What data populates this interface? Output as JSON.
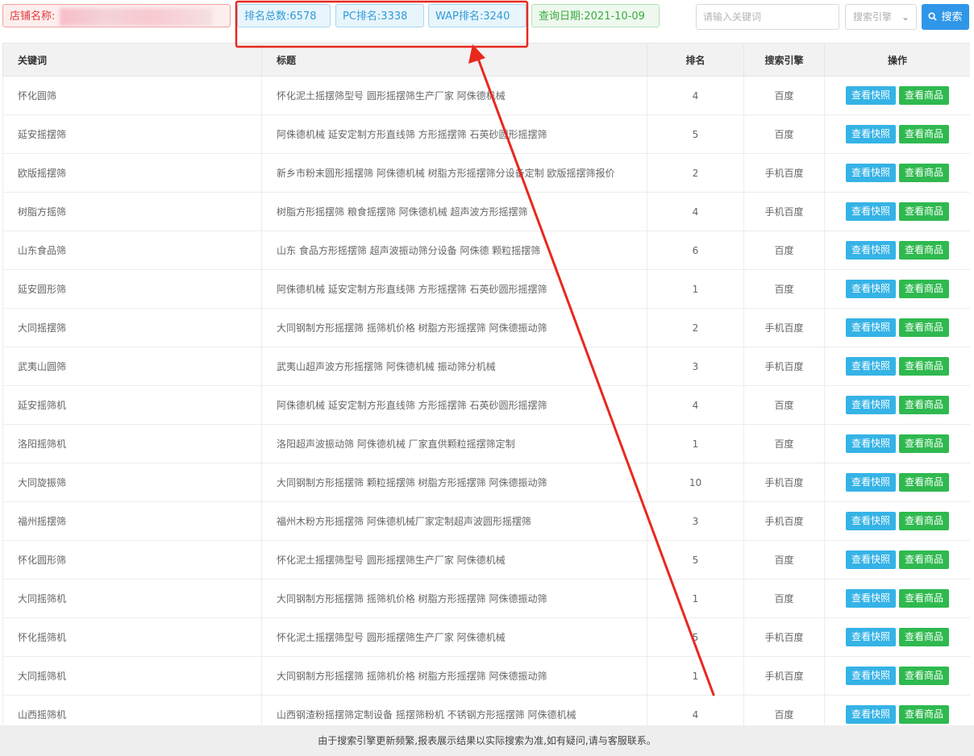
{
  "header": {
    "shop_label": "店铺名称:",
    "total_rank": "排名总数:6578",
    "pc_rank": "PC排名:3338",
    "wap_rank": "WAP排名:3240",
    "query_date": "查询日期:2021-10-09"
  },
  "search": {
    "placeholder": "请输入关键词",
    "engine_placeholder": "搜索引擎",
    "button_label": "搜索"
  },
  "table": {
    "columns": [
      "关键词",
      "标题",
      "排名",
      "搜索引擎",
      "操作"
    ],
    "snapshot_label": "查看快照",
    "goods_label": "查看商品",
    "rows": [
      {
        "keyword": "怀化圆筛",
        "title": "怀化泥土摇摆筛型号 圆形摇摆筛生产厂家 阿侏德机械",
        "rank": "4",
        "engine": "百度"
      },
      {
        "keyword": "延安摇摆筛",
        "title": "阿侏德机械 延安定制方形直线筛 方形摇摆筛 石英砂圆形摇摆筛",
        "rank": "5",
        "engine": "百度"
      },
      {
        "keyword": "欧版摇摆筛",
        "title": "新乡市粉末圆形摇摆筛 阿侏德机械 树脂方形摇摆筛分设备定制 欧版摇摆筛报价",
        "rank": "2",
        "engine": "手机百度"
      },
      {
        "keyword": "树脂方摇筛",
        "title": "树脂方形摇摆筛 粮食摇摆筛 阿侏德机械 超声波方形摇摆筛",
        "rank": "4",
        "engine": "手机百度"
      },
      {
        "keyword": "山东食品筛",
        "title": "山东 食品方形摇摆筛 超声波振动筛分设备 阿侏德 颗粒摇摆筛",
        "rank": "6",
        "engine": "百度"
      },
      {
        "keyword": "延安圆形筛",
        "title": "阿侏德机械 延安定制方形直线筛 方形摇摆筛 石英砂圆形摇摆筛",
        "rank": "1",
        "engine": "百度"
      },
      {
        "keyword": "大同摇摆筛",
        "title": "大同钢制方形摇摆筛 摇筛机价格 树脂方形摇摆筛 阿侏德振动筛",
        "rank": "2",
        "engine": "手机百度"
      },
      {
        "keyword": "武夷山圆筛",
        "title": "武夷山超声波方形摇摆筛 阿侏德机械 振动筛分机械",
        "rank": "3",
        "engine": "手机百度"
      },
      {
        "keyword": "延安摇筛机",
        "title": "阿侏德机械 延安定制方形直线筛 方形摇摆筛 石英砂圆形摇摆筛",
        "rank": "4",
        "engine": "百度"
      },
      {
        "keyword": "洛阳摇筛机",
        "title": "洛阳超声波振动筛 阿侏德机械 厂家直供颗粒摇摆筛定制",
        "rank": "1",
        "engine": "百度"
      },
      {
        "keyword": "大同旋振筛",
        "title": "大同钢制方形摇摆筛 颗粒摇摆筛 树脂方形摇摆筛 阿侏德振动筛",
        "rank": "10",
        "engine": "手机百度"
      },
      {
        "keyword": "福州摇摆筛",
        "title": "福州木粉方形摇摆筛 阿侏德机械厂家定制超声波圆形摇摆筛",
        "rank": "3",
        "engine": "手机百度"
      },
      {
        "keyword": "怀化圆形筛",
        "title": "怀化泥土摇摆筛型号 圆形摇摆筛生产厂家 阿侏德机械",
        "rank": "5",
        "engine": "百度"
      },
      {
        "keyword": "大同摇筛机",
        "title": "大同钢制方形摇摆筛 摇筛机价格 树脂方形摇摆筛 阿侏德振动筛",
        "rank": "1",
        "engine": "百度"
      },
      {
        "keyword": "怀化摇筛机",
        "title": "怀化泥土摇摆筛型号 圆形摇摆筛生产厂家 阿侏德机械",
        "rank": "5",
        "engine": "手机百度"
      },
      {
        "keyword": "大同摇筛机",
        "title": "大同钢制方形摇摆筛 摇筛机价格 树脂方形摇摆筛 阿侏德振动筛",
        "rank": "1",
        "engine": "手机百度"
      },
      {
        "keyword": "山西摇筛机",
        "title": "山西钢渣粉摇摆筛定制设备 摇摆筛粉机 不锈钢方形摇摆筛 阿侏德机械",
        "rank": "4",
        "engine": "百度"
      }
    ]
  },
  "footer": {
    "notice": "由于搜索引擎更新频繁,报表展示结果以实际搜索为准,如有疑问,请与客服联系。"
  },
  "colors": {
    "annotation": "#e8281e",
    "snapshot_button": "#35b3e6",
    "goods_button": "#2fb94f",
    "search_button": "#2f96e8"
  }
}
